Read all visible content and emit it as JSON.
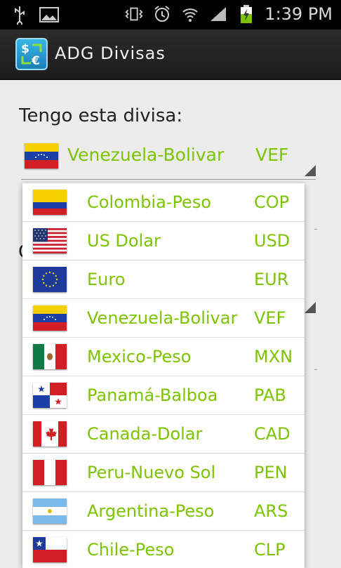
{
  "status_bar": {
    "time": "1:39 PM",
    "icons": [
      "usb-icon",
      "gallery-icon",
      "vibrate-icon",
      "alarm-icon",
      "wifi-icon",
      "signal-icon",
      "battery-charging-icon"
    ]
  },
  "action_bar": {
    "title": "ADG Divisas",
    "icon": "dollar-euro-exchange-icon"
  },
  "main": {
    "have_label": "Tengo esta divisa:",
    "selected": {
      "name": "Venezuela-Bolivar",
      "code": "VEF",
      "flag": "venezuela"
    },
    "second_label_initial": "Q"
  },
  "dropdown": {
    "items": [
      {
        "name": "Colombia-Peso",
        "code": "COP",
        "flag": "colombia"
      },
      {
        "name": "US Dolar",
        "code": "USD",
        "flag": "usa"
      },
      {
        "name": "Euro",
        "code": "EUR",
        "flag": "eu"
      },
      {
        "name": "Venezuela-Bolivar",
        "code": "VEF",
        "flag": "venezuela"
      },
      {
        "name": "Mexico-Peso",
        "code": "MXN",
        "flag": "mexico"
      },
      {
        "name": "Panamá-Balboa",
        "code": "PAB",
        "flag": "panama"
      },
      {
        "name": "Canada-Dolar",
        "code": "CAD",
        "flag": "canada"
      },
      {
        "name": "Peru-Nuevo Sol",
        "code": "PEN",
        "flag": "peru"
      },
      {
        "name": "Argentina-Peso",
        "code": "ARS",
        "flag": "argentina"
      },
      {
        "name": "Chile-Peso",
        "code": "CLP",
        "flag": "chile"
      }
    ]
  },
  "colors": {
    "accent_text": "#7cc400",
    "status_bar": "#000000",
    "action_bar": "#222222"
  }
}
